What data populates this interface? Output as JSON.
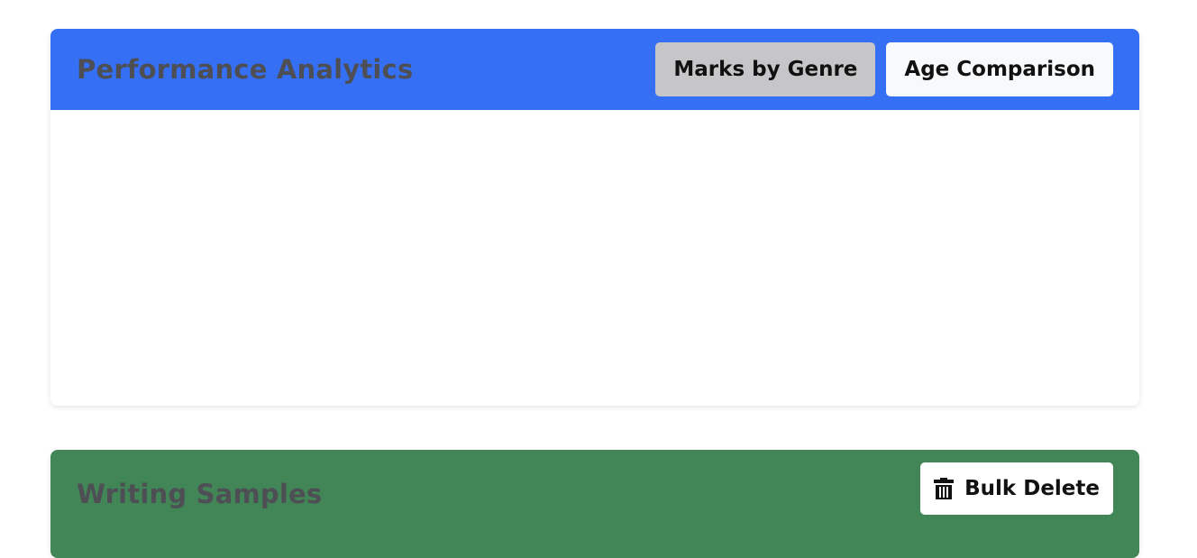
{
  "analytics": {
    "title": "Performance Analytics",
    "tabs": [
      {
        "label": "Marks by Genre",
        "active": true
      },
      {
        "label": "Age Comparison",
        "active": false
      }
    ],
    "header_color": "#3570f4"
  },
  "samples": {
    "title": "Writing Samples",
    "bulk_delete_label": "Bulk Delete",
    "bulk_delete_icon": "trash-icon",
    "header_color": "#428657"
  }
}
